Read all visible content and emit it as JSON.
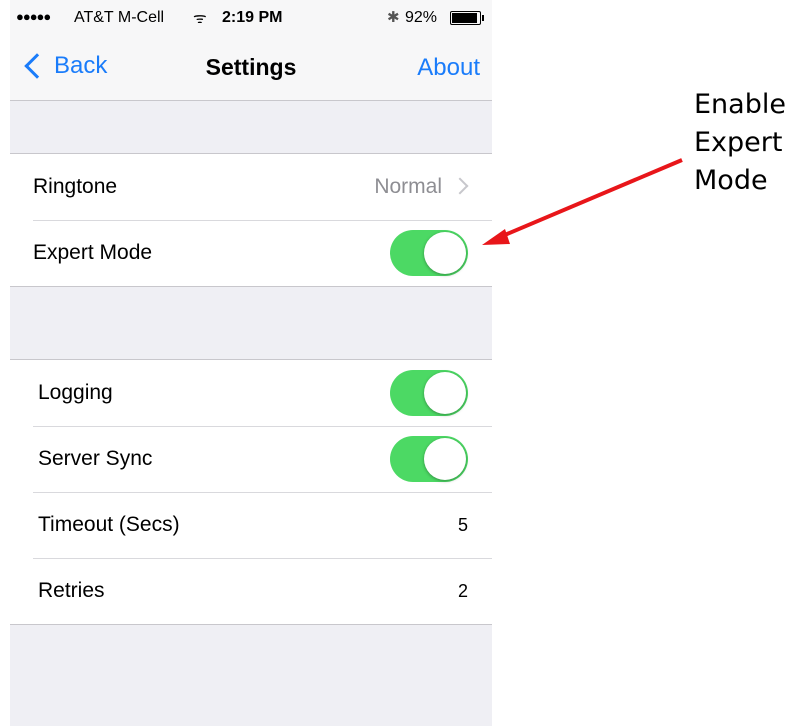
{
  "status_bar": {
    "signal_dots": "●●●●●",
    "carrier": "AT&T M-Cell",
    "wifi_icon": "wifi-icon",
    "time": "2:19 PM",
    "bluetooth_icon": "bluetooth-icon",
    "battery_percent": "92%",
    "battery_level": 0.92
  },
  "nav": {
    "back_label": "Back",
    "title": "Settings",
    "right_label": "About"
  },
  "section1": {
    "rows": [
      {
        "label": "Ringtone",
        "detail": "Normal"
      },
      {
        "label": "Expert Mode",
        "toggle_on": true
      }
    ]
  },
  "section2": {
    "rows": [
      {
        "label": "Logging",
        "toggle_on": true
      },
      {
        "label": "Server Sync",
        "toggle_on": true
      },
      {
        "label": "Timeout (Secs)",
        "value": "5"
      },
      {
        "label": "Retries",
        "value": "2"
      }
    ]
  },
  "annotation": {
    "lines": [
      "Enable",
      "Expert",
      "Mode"
    ]
  },
  "colors": {
    "accent": "#1a7cfa",
    "toggle_on": "#4cd964",
    "arrow": "#e8161a",
    "background": "#efeff4"
  }
}
